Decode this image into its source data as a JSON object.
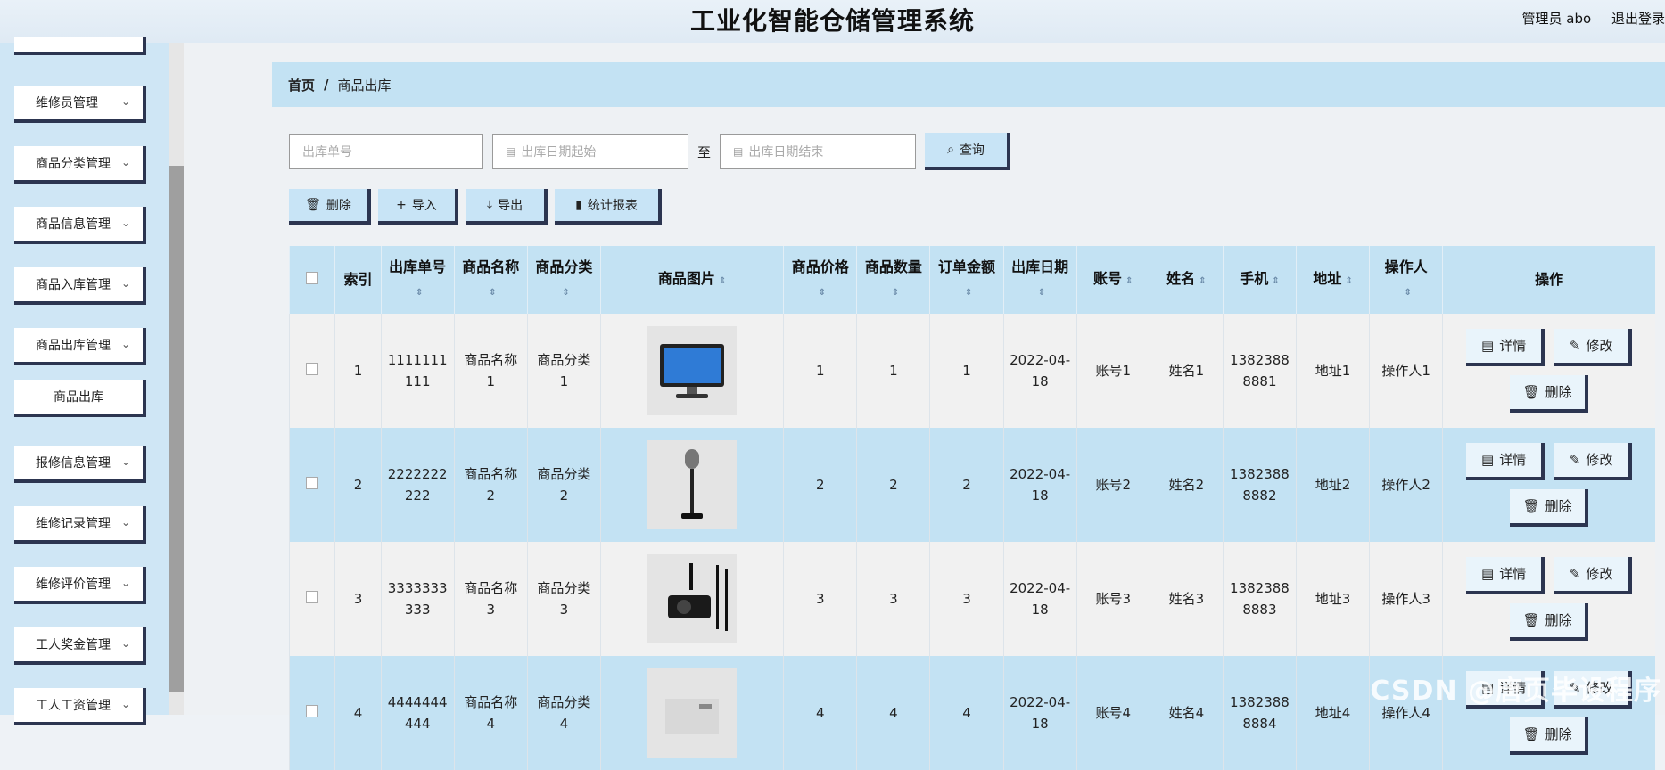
{
  "header": {
    "title": "工业化智能仓储管理系统",
    "user_label": "管理员 abo",
    "logout_label": "退出登录"
  },
  "sidebar": {
    "items": [
      {
        "label": "维修员管理"
      },
      {
        "label": "商品分类管理"
      },
      {
        "label": "商品信息管理"
      },
      {
        "label": "商品入库管理"
      },
      {
        "label": "商品出库管理"
      },
      {
        "label": "报修信息管理"
      },
      {
        "label": "维修记录管理"
      },
      {
        "label": "维修评价管理"
      },
      {
        "label": "工人奖金管理"
      },
      {
        "label": "工人工资管理"
      }
    ],
    "subitem": "商品出库",
    "chevron": "chevron-down-icon"
  },
  "breadcrumb": {
    "home": "首页",
    "sep": "/",
    "current": "商品出库"
  },
  "search": {
    "order_placeholder": "出库单号",
    "date_start_placeholder": "出库日期起始",
    "to_label": "至",
    "date_end_placeholder": "出库日期结束",
    "query_label": "查询"
  },
  "toolbar": {
    "delete_label": "删除",
    "import_label": "导入",
    "export_label": "导出",
    "report_label": "统计报表"
  },
  "table": {
    "headers": {
      "index": "索引",
      "order_no": "出库单号",
      "name": "商品名称",
      "category": "商品分类",
      "image": "商品图片",
      "price": "商品价格",
      "qty": "商品数量",
      "amount": "订单金额",
      "date": "出库日期",
      "account": "账号",
      "person": "姓名",
      "phone": "手机",
      "address": "地址",
      "operator": "操作人",
      "actions": "操作"
    },
    "rows": [
      {
        "index": "1",
        "order_no": "1111111111",
        "name": "商品名称1",
        "category": "商品分类1",
        "image": "monitor",
        "price": "1",
        "qty": "1",
        "amount": "1",
        "date": "2022-04-18",
        "account": "账号1",
        "person": "姓名1",
        "phone": "13823888881",
        "address": "地址1",
        "operator": "操作人1"
      },
      {
        "index": "2",
        "order_no": "2222222222",
        "name": "商品名称2",
        "category": "商品分类2",
        "image": "microphone",
        "price": "2",
        "qty": "2",
        "amount": "2",
        "date": "2022-04-18",
        "account": "账号2",
        "person": "姓名2",
        "phone": "13823888882",
        "address": "地址2",
        "operator": "操作人2"
      },
      {
        "index": "3",
        "order_no": "3333333333",
        "name": "商品名称3",
        "category": "商品分类3",
        "image": "projector",
        "price": "3",
        "qty": "3",
        "amount": "3",
        "date": "2022-04-18",
        "account": "账号3",
        "person": "姓名3",
        "phone": "13823888883",
        "address": "地址3",
        "operator": "操作人3"
      },
      {
        "index": "4",
        "order_no": "4444444444",
        "name": "商品名称4",
        "category": "商品分类4",
        "image": "device",
        "price": "4",
        "qty": "4",
        "amount": "4",
        "date": "2022-04-18",
        "account": "账号4",
        "person": "姓名4",
        "phone": "13823888884",
        "address": "地址4",
        "operator": "操作人4"
      }
    ],
    "row_actions": {
      "detail": "详情",
      "edit": "修改",
      "delete": "删除"
    }
  },
  "watermark": "CSDN @唐页毕设程序"
}
